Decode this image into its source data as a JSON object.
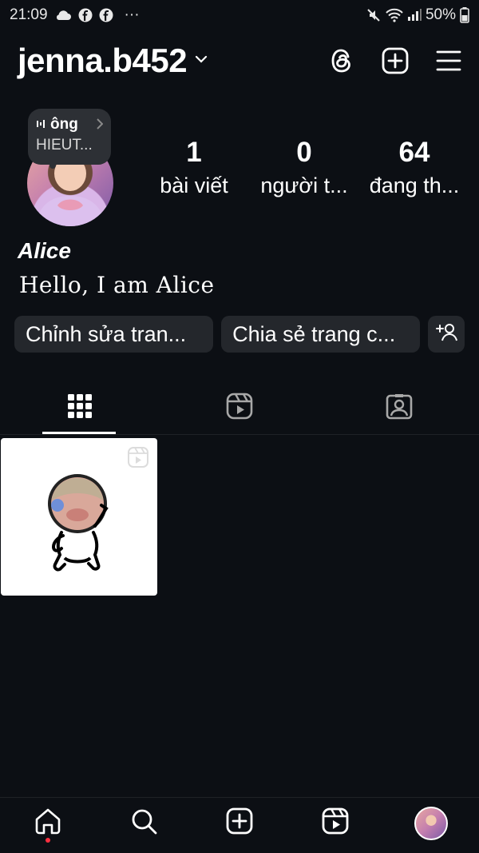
{
  "status_bar": {
    "time": "21:09",
    "more": "···",
    "battery": "50%",
    "icons": [
      "cloud-icon",
      "facebook-icon",
      "facebook-icon",
      "mute-icon",
      "wifi-icon",
      "signal-icon",
      "battery-icon"
    ]
  },
  "header": {
    "username": "jenna.b452"
  },
  "note": {
    "line1": "ông",
    "line2": "HIEUT..."
  },
  "stats": {
    "posts_count": "1",
    "posts_label": "bài viết",
    "followers_count": "0",
    "followers_label": "người t...",
    "following_count": "64",
    "following_label": "đang th..."
  },
  "profile": {
    "display_name": "Alice",
    "bio": "Hello, I am Alice"
  },
  "actions": {
    "edit_label": "Chỉnh sửa tran...",
    "share_label": "Chia sẻ trang c..."
  },
  "tabs": [
    "grid-tab",
    "reels-tab",
    "tagged-tab"
  ],
  "colors": {
    "background": "#0c0f14",
    "pill": "#24272c",
    "notification_dot": "#ff3040"
  }
}
